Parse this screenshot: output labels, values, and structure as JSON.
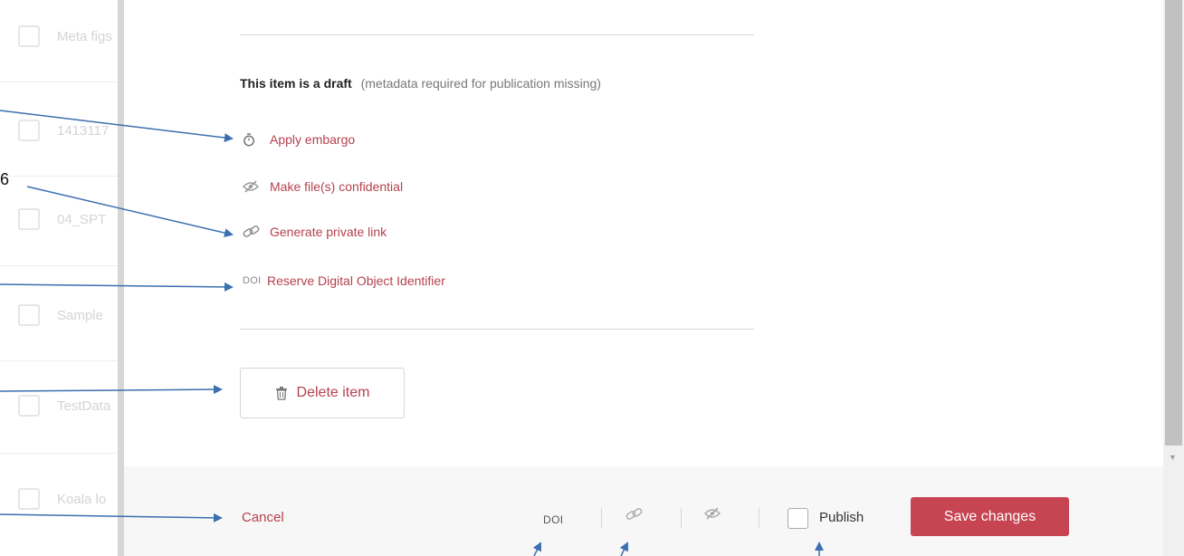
{
  "left_list": {
    "items": [
      {
        "label": "Meta figs"
      },
      {
        "label": "1413117"
      },
      {
        "label": "04_SPT"
      },
      {
        "label": "Sample"
      },
      {
        "label": "TestData"
      },
      {
        "label": "Koala lo"
      }
    ]
  },
  "status": {
    "title": "This item is a draft",
    "note": "(metadata required for publication missing)"
  },
  "actions": {
    "embargo": "Apply embargo",
    "confidential": "Make file(s) confidential",
    "private_link": "Generate private link",
    "doi_badge": "DOI",
    "doi": "Reserve Digital Object Identifier"
  },
  "delete_label": "Delete item",
  "footer": {
    "cancel": "Cancel",
    "doi_badge": "DOI",
    "publish_label": "Publish",
    "save_label": "Save changes"
  },
  "annotation": {
    "number_fragment": "6"
  },
  "colors": {
    "accent": "#b5414d",
    "primary_button": "#c74453",
    "arrow": "#3a6fb0"
  }
}
